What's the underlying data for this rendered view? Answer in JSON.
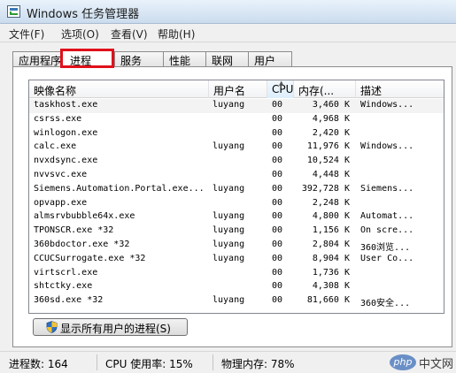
{
  "window": {
    "title": "Windows 任务管理器"
  },
  "menu": [
    {
      "label": "文件(F)"
    },
    {
      "label": "选项(O)"
    },
    {
      "label": "查看(V)"
    },
    {
      "label": "帮助(H)"
    }
  ],
  "tabs": [
    {
      "label": "应用程序"
    },
    {
      "label": "进程",
      "active": true
    },
    {
      "label": "服务"
    },
    {
      "label": "性能"
    },
    {
      "label": "联网"
    },
    {
      "label": "用户"
    }
  ],
  "columns": [
    {
      "label": "映像名称"
    },
    {
      "label": "用户名"
    },
    {
      "label": "CPU",
      "sorted": true
    },
    {
      "label": "内存(..."
    },
    {
      "label": "描述"
    }
  ],
  "rows": [
    {
      "name": "taskhost.exe",
      "user": "luyang",
      "cpu": "00",
      "mem": "3,460 K",
      "desc": "Windows..."
    },
    {
      "name": "csrss.exe",
      "user": "",
      "cpu": "00",
      "mem": "4,968 K",
      "desc": ""
    },
    {
      "name": "winlogon.exe",
      "user": "",
      "cpu": "00",
      "mem": "2,420 K",
      "desc": ""
    },
    {
      "name": "calc.exe",
      "user": "luyang",
      "cpu": "00",
      "mem": "11,976 K",
      "desc": "Windows..."
    },
    {
      "name": "nvxdsync.exe",
      "user": "",
      "cpu": "00",
      "mem": "10,524 K",
      "desc": ""
    },
    {
      "name": "nvvsvc.exe",
      "user": "",
      "cpu": "00",
      "mem": "4,448 K",
      "desc": ""
    },
    {
      "name": "Siemens.Automation.Portal.exe...",
      "user": "luyang",
      "cpu": "00",
      "mem": "392,728 K",
      "desc": "Siemens..."
    },
    {
      "name": "opvapp.exe",
      "user": "",
      "cpu": "00",
      "mem": "2,248 K",
      "desc": ""
    },
    {
      "name": "almsrvbubble64x.exe",
      "user": "luyang",
      "cpu": "00",
      "mem": "4,800 K",
      "desc": "Automat..."
    },
    {
      "name": "TPONSCR.exe *32",
      "user": "luyang",
      "cpu": "00",
      "mem": "1,156 K",
      "desc": "On scre..."
    },
    {
      "name": "360bdoctor.exe *32",
      "user": "luyang",
      "cpu": "00",
      "mem": "2,804 K",
      "desc": "360浏览..."
    },
    {
      "name": "CCUCSurrogate.exe *32",
      "user": "luyang",
      "cpu": "00",
      "mem": "8,904 K",
      "desc": "User Co..."
    },
    {
      "name": "virtscrl.exe",
      "user": "",
      "cpu": "00",
      "mem": "1,736 K",
      "desc": ""
    },
    {
      "name": "shtctky.exe",
      "user": "",
      "cpu": "00",
      "mem": "4,308 K",
      "desc": ""
    },
    {
      "name": "360sd.exe *32",
      "user": "luyang",
      "cpu": "00",
      "mem": "81,660 K",
      "desc": "360安全..."
    }
  ],
  "show_all_button": {
    "label": "显示所有用户的进程(S)"
  },
  "status": [
    {
      "label": "进程数: 164"
    },
    {
      "label": "CPU 使用率: 15%"
    },
    {
      "label": "物理内存: 78%"
    }
  ],
  "watermark": {
    "logo": "php",
    "text": "中文网"
  },
  "colors": {
    "highlight_border": "#e0101c"
  }
}
